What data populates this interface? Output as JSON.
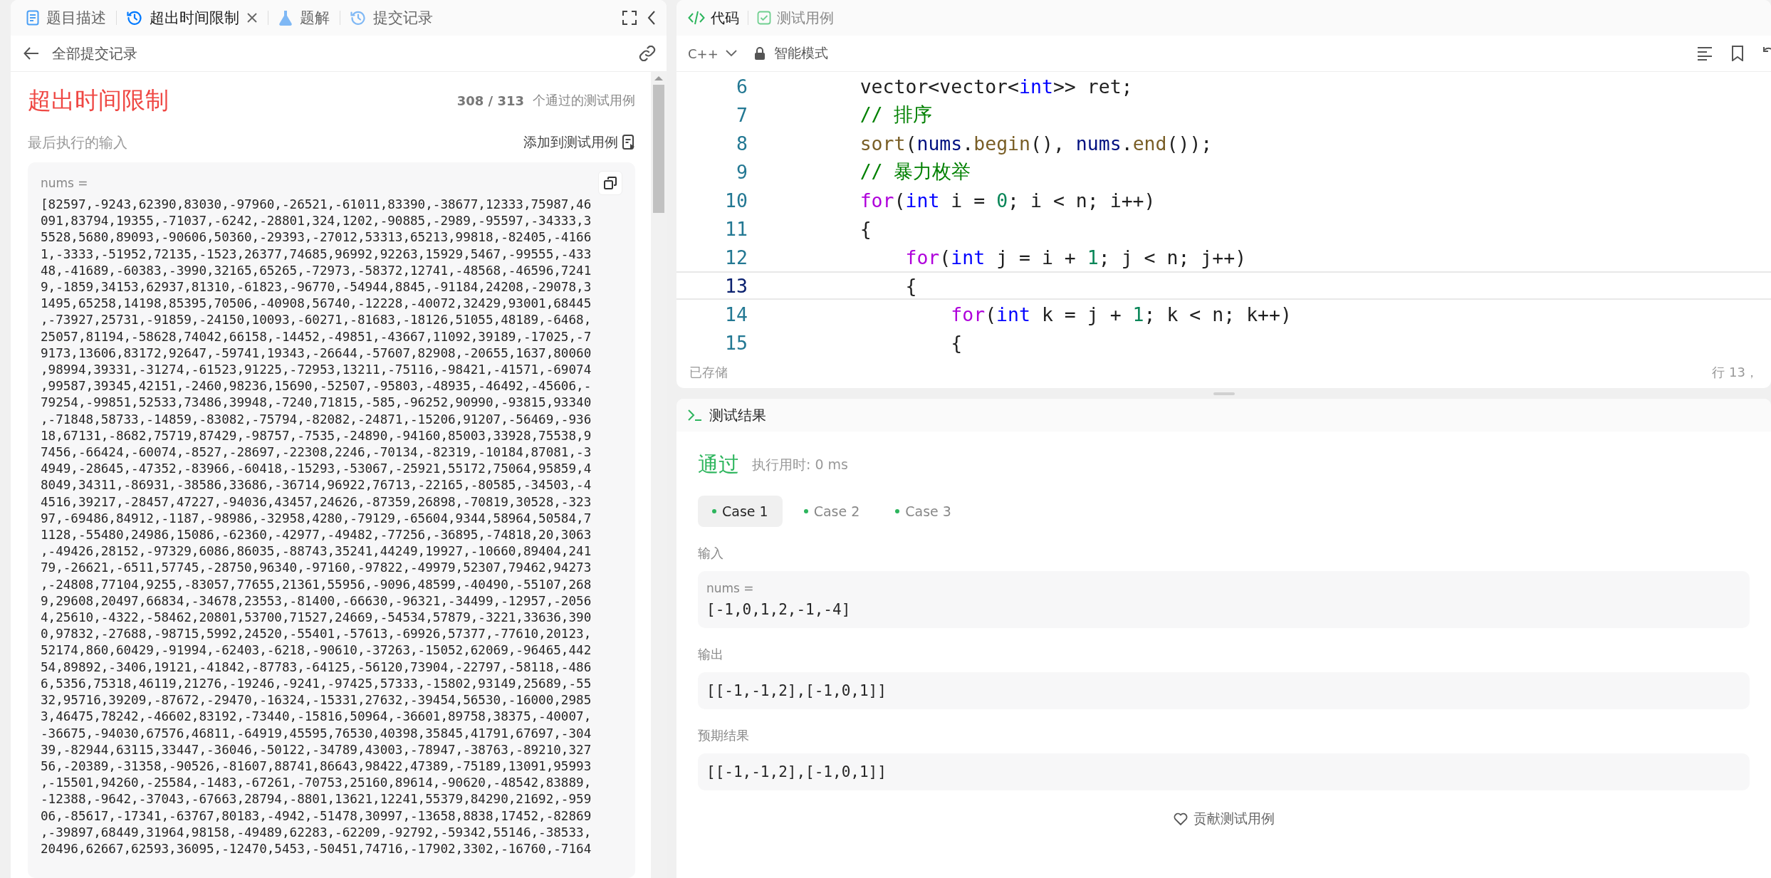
{
  "problem_panel": {
    "tabs": [
      {
        "label": "题目描述",
        "kind": "doc",
        "selected": false,
        "closable": false
      },
      {
        "label": "超出时间限制",
        "kind": "history",
        "selected": true,
        "closable": true
      },
      {
        "label": "题解",
        "kind": "flask",
        "selected": false,
        "closable": false
      },
      {
        "label": "提交记录",
        "kind": "history",
        "selected": false,
        "closable": false
      }
    ],
    "back_link": "全部提交记录",
    "result": {
      "status": "超出时间限制",
      "passed": "308 / 313",
      "passed_suffix": "个通过的测试用例",
      "last_input_label": "最后执行的输入",
      "add_to_tests": "添加到测试用例",
      "input_name": "nums =",
      "input_value": "[82597,-9243,62390,83030,-97960,-26521,-61011,83390,-38677,12333,75987,46091,83794,19355,-71037,-6242,-28801,324,1202,-90885,-2989,-95597,-34333,35528,5680,89093,-90606,50360,-29393,-27012,53313,65213,99818,-82405,-41661,-3333,-51952,72135,-1523,26377,74685,96992,92263,15929,5467,-99555,-43348,-41689,-60383,-3990,32165,65265,-72973,-58372,12741,-48568,-46596,72419,-1859,34153,62937,81310,-61823,-96770,-54944,8845,-91184,24208,-29078,31495,65258,14198,85395,70506,-40908,56740,-12228,-40072,32429,93001,68445,-73927,25731,-91859,-24150,10093,-60271,-81683,-18126,51055,48189,-6468,25057,81194,-58628,74042,66158,-14452,-49851,-43667,11092,39189,-17025,-79173,13606,83172,92647,-59741,19343,-26644,-57607,82908,-20655,1637,80060,98994,39331,-31274,-61523,91225,-72953,13211,-75116,-98421,-41571,-69074,99587,39345,42151,-2460,98236,15690,-52507,-95803,-48935,-46492,-45606,-79254,-99851,52533,73486,39948,-7240,71815,-585,-96252,90990,-93815,93340,-71848,58733,-14859,-83082,-75794,-82082,-24871,-15206,91207,-56469,-93618,67131,-8682,75719,87429,-98757,-7535,-24890,-94160,85003,33928,75538,97456,-66424,-60074,-8527,-28697,-22308,2246,-70134,-82319,-10184,87081,-34949,-28645,-47352,-83966,-60418,-15293,-53067,-25921,55172,75064,95859,48049,34311,-86931,-38586,33686,-36714,96922,76713,-22165,-80585,-34503,-44516,39217,-28457,47227,-94036,43457,24626,-87359,26898,-70819,30528,-32397,-69486,84912,-1187,-98986,-32958,4280,-79129,-65604,9344,58964,50584,71128,-55480,24986,15086,-62360,-42977,-49482,-77256,-36895,-74818,20,3063,-49426,28152,-97329,6086,86035,-88743,35241,44249,19927,-10660,89404,24179,-26621,-6511,57745,-28750,96340,-97160,-97822,-49979,52307,79462,94273,-24808,77104,9255,-83057,77655,21361,55956,-9096,48599,-40490,-55107,2689,29608,20497,66834,-34678,23553,-81400,-66630,-96321,-34499,-12957,-20564,25610,-4322,-58462,20801,53700,71527,24669,-54534,57879,-3221,33636,3900,97832,-27688,-98715,5992,24520,-55401,-57613,-69926,57377,-77610,20123,52174,860,60429,-91994,-62403,-6218,-90610,-37263,-15052,62069,-96465,44254,89892,-3406,19121,-41842,-87783,-64125,-56120,73904,-22797,-58118,-4866,5356,75318,46119,21276,-19246,-9241,-97425,57333,-15802,93149,25689,-5532,95716,39209,-87672,-29470,-16324,-15331,27632,-39454,56530,-16000,29853,46475,78242,-46602,83192,-73440,-15816,50964,-36601,89758,38375,-40007,-36675,-94030,67576,46811,-64919,45595,76530,40398,35845,41791,67697,-30439,-82944,63115,33447,-36046,-50122,-34789,43003,-78947,-38763,-89210,32756,-20389,-31358,-90526,-81607,88741,86643,98422,47389,-75189,13091,95993,-15501,94260,-25584,-1483,-67261,-70753,25160,89614,-90620,-48542,83889,-12388,-9642,-37043,-67663,28794,-8801,13621,12241,55379,84290,21692,-95906,-85617,-17341,-63767,80183,-4942,-51478,30997,-13658,8838,17452,-82869,-39897,68449,31964,98158,-49489,62283,-62209,-92792,-59342,55146,-38533,20496,62667,62593,36095,-12470,5453,-50451,74716,-17902,3302,-16760,-7164"
    }
  },
  "editor": {
    "tabs": [
      {
        "label": "代码",
        "kind": "code",
        "selected": true
      },
      {
        "label": "测试用例",
        "kind": "check",
        "selected": false
      }
    ],
    "language": "C++",
    "mode": "智能模式",
    "lines": [
      {
        "number": "6",
        "current": false,
        "tokens": [
          {
            "t": "        vector<vector<",
            "kind": "plain"
          },
          {
            "t": "int",
            "kind": "type"
          },
          {
            "t": ">> ret;",
            "kind": "plain"
          }
        ]
      },
      {
        "number": "7",
        "current": false,
        "tokens": [
          {
            "t": "        // 排序",
            "kind": "comment"
          }
        ]
      },
      {
        "number": "8",
        "current": false,
        "tokens": [
          {
            "t": "        sort",
            "kind": "fn"
          },
          {
            "t": "(",
            "kind": "plain"
          },
          {
            "t": "nums",
            "kind": "var"
          },
          {
            "t": ".",
            "kind": "plain"
          },
          {
            "t": "begin",
            "kind": "fn"
          },
          {
            "t": "(), ",
            "kind": "plain"
          },
          {
            "t": "nums",
            "kind": "var"
          },
          {
            "t": ".",
            "kind": "plain"
          },
          {
            "t": "end",
            "kind": "fn"
          },
          {
            "t": "());",
            "kind": "plain"
          }
        ]
      },
      {
        "number": "9",
        "current": false,
        "tokens": [
          {
            "t": "        // 暴力枚举",
            "kind": "comment"
          }
        ]
      },
      {
        "number": "10",
        "current": false,
        "tokens": [
          {
            "t": "        for",
            "kind": "kw"
          },
          {
            "t": "(",
            "kind": "plain"
          },
          {
            "t": "int",
            "kind": "type"
          },
          {
            "t": " i = ",
            "kind": "plain"
          },
          {
            "t": "0",
            "kind": "num"
          },
          {
            "t": "; i < n; i++)",
            "kind": "plain"
          }
        ]
      },
      {
        "number": "11",
        "current": false,
        "tokens": [
          {
            "t": "        {",
            "kind": "plain"
          }
        ]
      },
      {
        "number": "12",
        "current": false,
        "tokens": [
          {
            "t": "            for",
            "kind": "kw"
          },
          {
            "t": "(",
            "kind": "plain"
          },
          {
            "t": "int",
            "kind": "type"
          },
          {
            "t": " j = i + ",
            "kind": "plain"
          },
          {
            "t": "1",
            "kind": "num"
          },
          {
            "t": "; j < n; j++)",
            "kind": "plain"
          }
        ]
      },
      {
        "number": "13",
        "current": true,
        "tokens": [
          {
            "t": "            {",
            "kind": "plain"
          }
        ]
      },
      {
        "number": "14",
        "current": false,
        "tokens": [
          {
            "t": "                for",
            "kind": "kw"
          },
          {
            "t": "(",
            "kind": "plain"
          },
          {
            "t": "int",
            "kind": "type"
          },
          {
            "t": " k = j + ",
            "kind": "plain"
          },
          {
            "t": "1",
            "kind": "num"
          },
          {
            "t": "; k < n; k++)",
            "kind": "plain"
          }
        ]
      },
      {
        "number": "15",
        "current": false,
        "tokens": [
          {
            "t": "                {",
            "kind": "plain"
          }
        ]
      }
    ],
    "status": "已存储",
    "cursor": "行 13，"
  },
  "test_result": {
    "title": "测试结果",
    "verdict": "通过",
    "runtime": "执行用时: 0 ms",
    "cases": [
      {
        "label": "Case 1",
        "selected": true
      },
      {
        "label": "Case 2",
        "selected": false
      },
      {
        "label": "Case 3",
        "selected": false
      }
    ],
    "sections": [
      {
        "label": "输入",
        "items": [
          {
            "name": "nums =",
            "value": "[-1,0,1,2,-1,-4]"
          }
        ]
      },
      {
        "label": "输出",
        "items": [
          {
            "value": "[[-1,-1,2],[-1,0,1]]"
          }
        ]
      },
      {
        "label": "预期结果",
        "items": [
          {
            "value": "[[-1,-1,2],[-1,0,1]]"
          }
        ]
      }
    ],
    "contribute": "贡献测试用例"
  }
}
